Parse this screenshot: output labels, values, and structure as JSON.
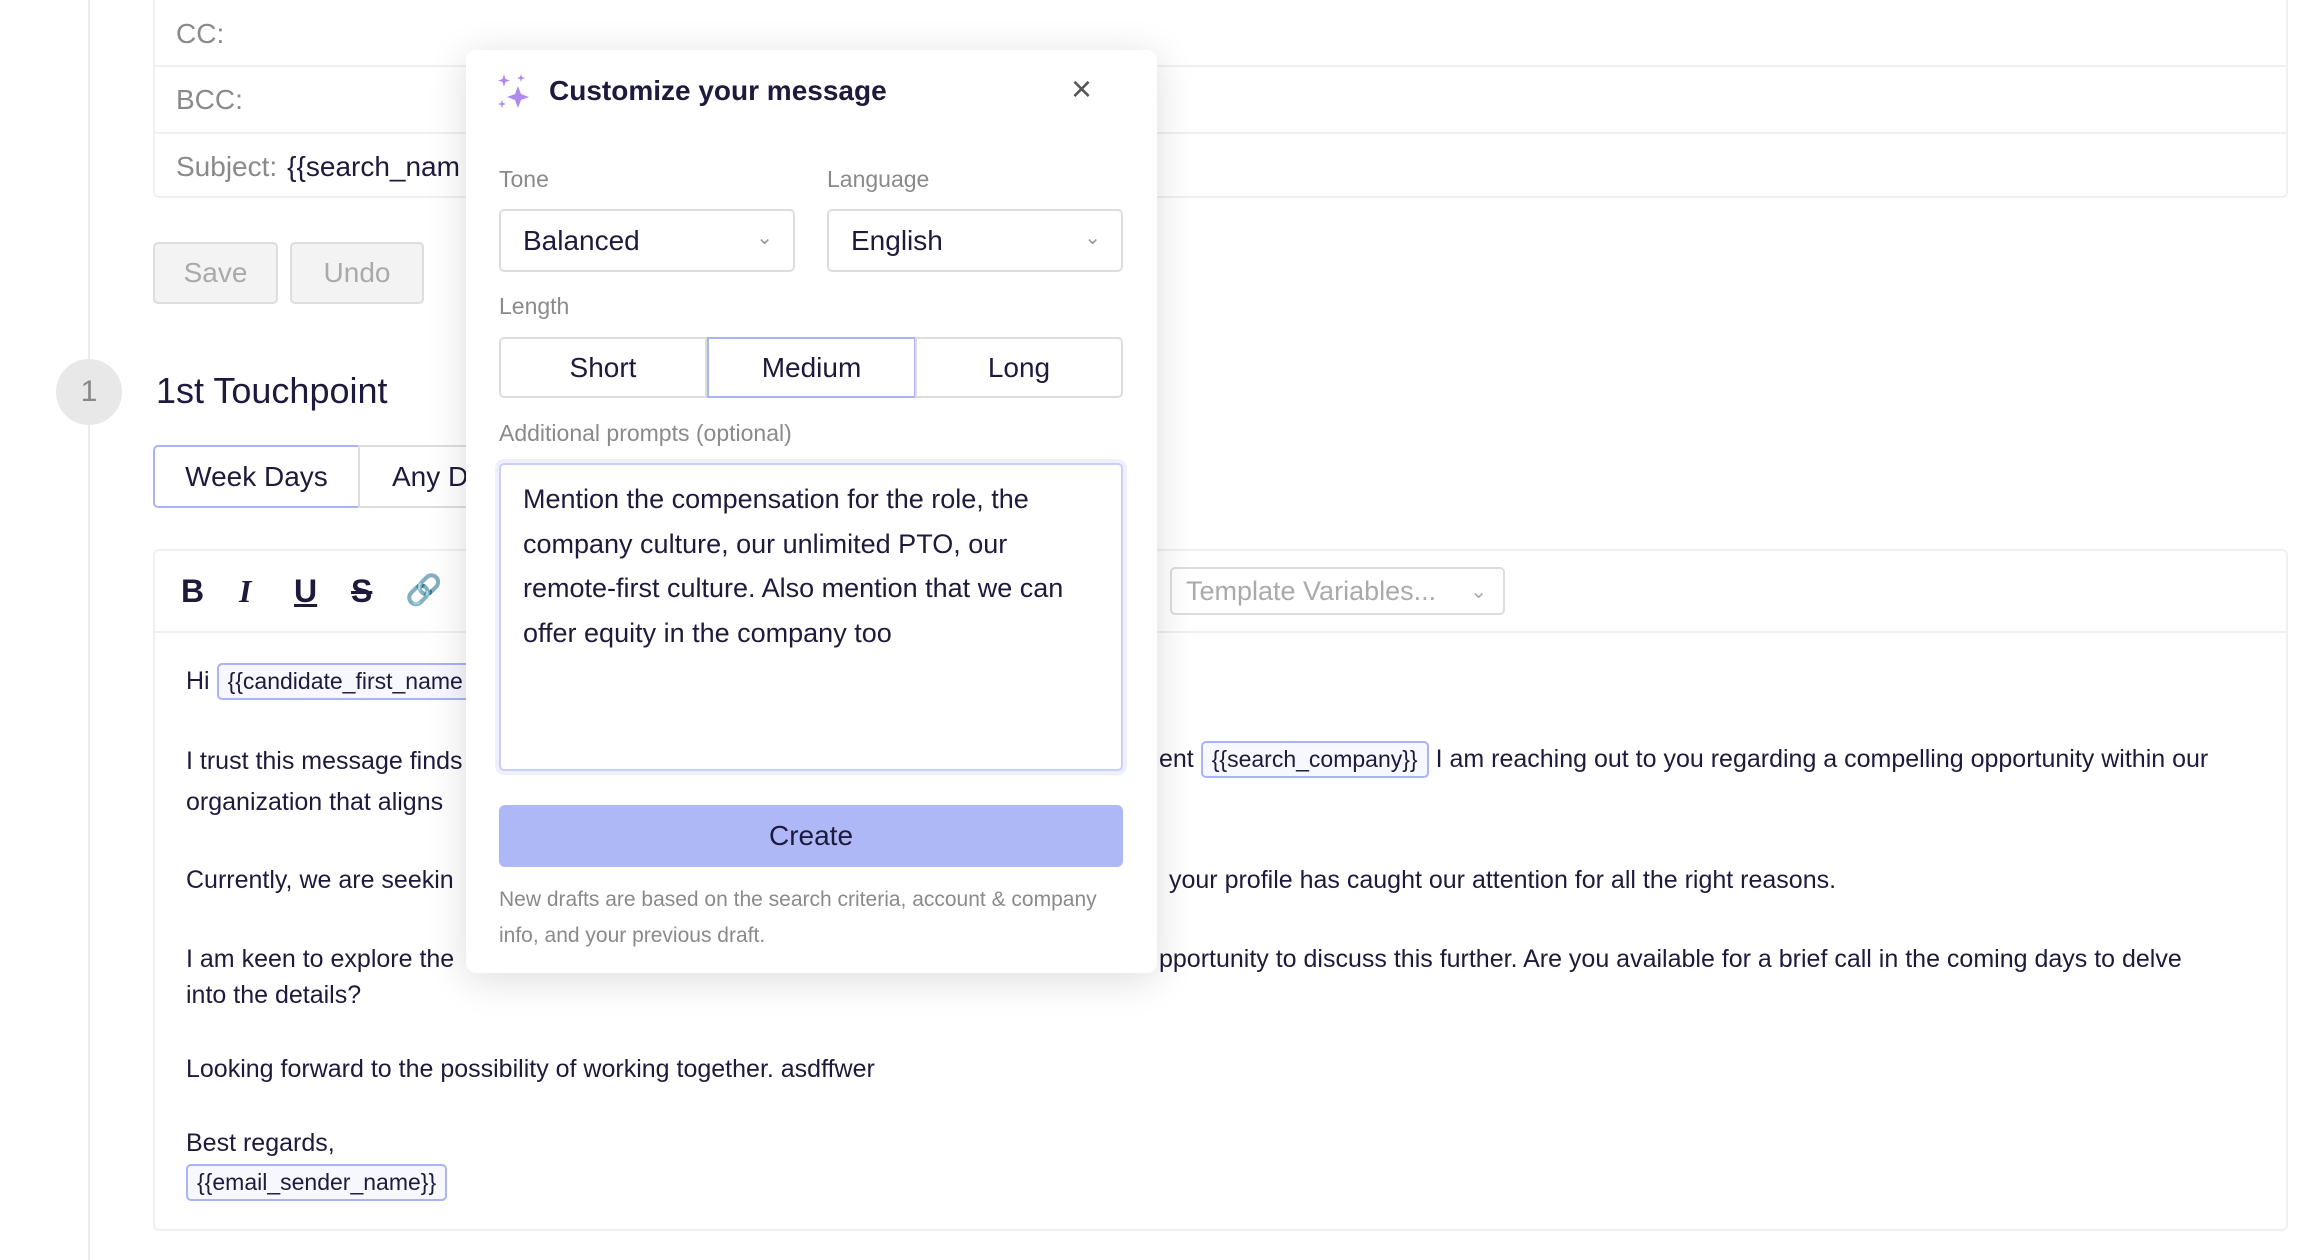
{
  "header": {
    "cc_label": "CC:",
    "bcc_label": "BCC:",
    "subject_label": "Subject:",
    "subject_value": "{{search_nam"
  },
  "actions": {
    "save": "Save",
    "undo": "Undo"
  },
  "touchpoint": {
    "number": "1",
    "title": "1st Touchpoint",
    "tabs": [
      "Week Days",
      "Any D"
    ]
  },
  "toolbar": {
    "bold": "B",
    "italic": "I",
    "underline": "U",
    "strike": "S",
    "template_vars": "Template Variables..."
  },
  "body": {
    "hi": "Hi",
    "chip_first_name": "{{candidate_first_name",
    "l1a": "I trust this message finds",
    "l1b": "ent",
    "chip_company": "{{search_company}}",
    "l1c": "I am reaching out to you regarding a compelling opportunity within our",
    "l2a": "organization that aligns",
    "l3a": "Currently, we are seekin",
    "l3b": "your profile has caught our attention for all the right reasons.",
    "l4a": "I am keen to explore the",
    "l4b": "pportunity to discuss this further. Are you available for a brief call in the coming days to delve",
    "l5": "into the details?",
    "l6": "Looking forward to the possibility of working together. asdffwer",
    "l7": "Best regards,",
    "chip_sender": "{{email_sender_name}}"
  },
  "modal": {
    "title": "Customize your message",
    "close": "×",
    "tone_label": "Tone",
    "tone_value": "Balanced",
    "language_label": "Language",
    "language_value": "English",
    "length_label": "Length",
    "length_options": [
      "Short",
      "Medium",
      "Long"
    ],
    "length_selected": "Medium",
    "prompts_label": "Additional prompts (optional)",
    "prompts_value": "Mention the compensation for the role, the company culture, our unlimited PTO, our remote-first culture. Also mention that we can offer equity in the company too",
    "create": "Create",
    "footnote": "New drafts are based on the search criteria, account & company info, and your previous draft.",
    "accent": "#aeb8f7"
  }
}
